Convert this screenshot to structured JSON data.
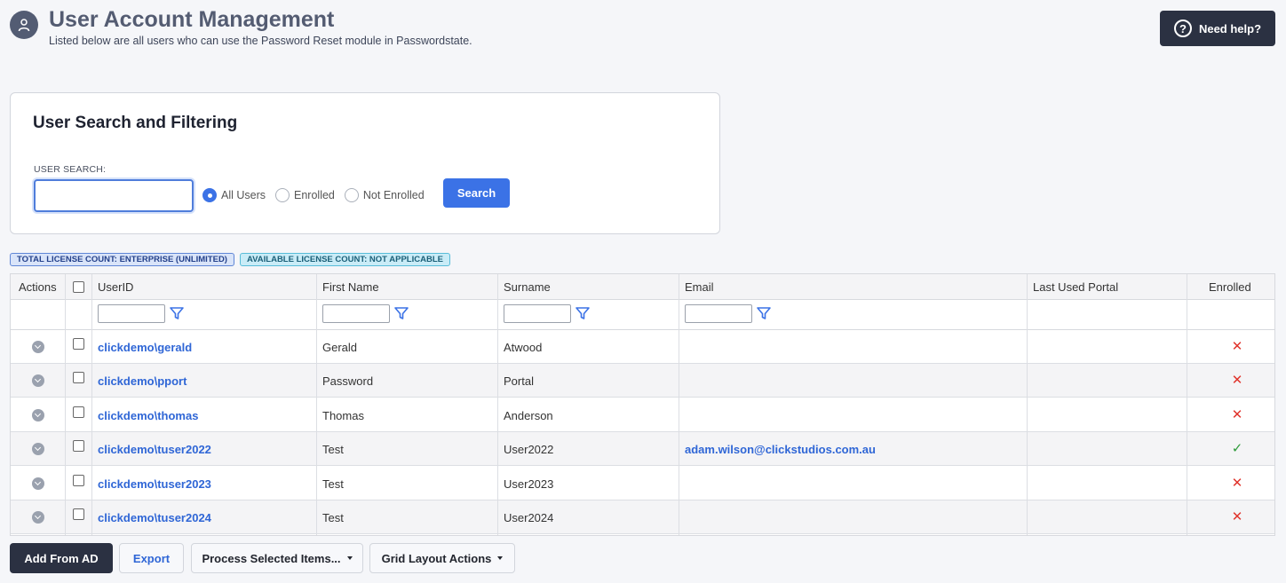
{
  "header": {
    "title": "User Account Management",
    "subtitle": "Listed below are all users who can use the Password Reset module in Passwordstate.",
    "help_label": "Need help?",
    "help_icon": "question-circle-icon",
    "avatar_icon": "user-icon"
  },
  "search": {
    "title": "User Search and Filtering",
    "label": "USER SEARCH:",
    "value": "",
    "radios": [
      "All Users",
      "Enrolled",
      "Not Enrolled"
    ],
    "selected": "All Users",
    "button": "Search"
  },
  "badges": {
    "total": "TOTAL LICENSE COUNT: ENTERPRISE (UNLIMITED)",
    "available": "AVAILABLE LICENSE COUNT: NOT APPLICABLE"
  },
  "grid": {
    "columns": [
      "Actions",
      "UserID",
      "First Name",
      "Surname",
      "Email",
      "Last Used Portal",
      "Enrolled"
    ],
    "rows": [
      {
        "userid": "clickdemo\\gerald",
        "first": "Gerald",
        "surname": "Atwood",
        "email": "",
        "portal": "",
        "enrolled": "✕"
      },
      {
        "userid": "clickdemo\\pport",
        "first": "Password",
        "surname": "Portal",
        "email": "",
        "portal": "",
        "enrolled": "✕"
      },
      {
        "userid": "clickdemo\\thomas",
        "first": "Thomas",
        "surname": "Anderson",
        "email": "",
        "portal": "",
        "enrolled": "✕"
      },
      {
        "userid": "clickdemo\\tuser2022",
        "first": "Test",
        "surname": "User2022",
        "email": "adam.wilson@clickstudios.com.au",
        "portal": "",
        "enrolled": "✓"
      },
      {
        "userid": "clickdemo\\tuser2023",
        "first": "Test",
        "surname": "User2023",
        "email": "",
        "portal": "",
        "enrolled": "✕"
      },
      {
        "userid": "clickdemo\\tuser2024",
        "first": "Test",
        "surname": "User2024",
        "email": "",
        "portal": "",
        "enrolled": "✕"
      }
    ]
  },
  "footer": {
    "add": "Add From AD",
    "export": "Export",
    "process": "Process Selected Items...",
    "layout": "Grid Layout Actions"
  },
  "colors": {
    "accent": "#3b72e6",
    "dark": "#2b3142",
    "error": "#e0342c",
    "success": "#2e9b3a"
  }
}
